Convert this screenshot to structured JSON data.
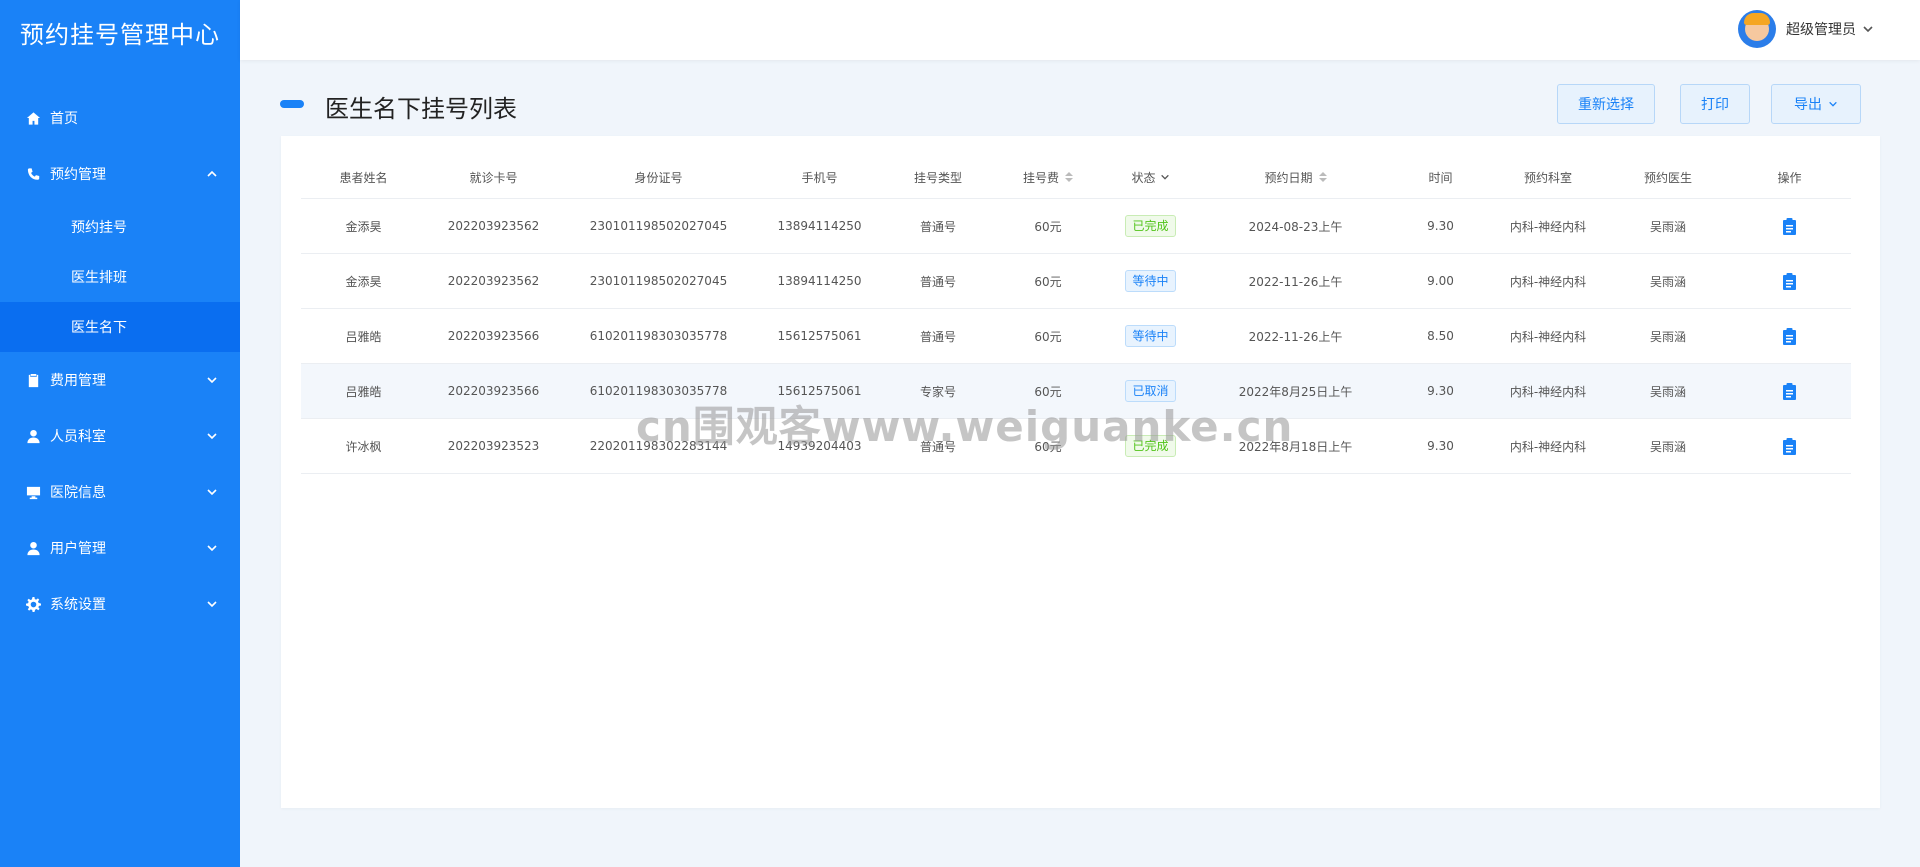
{
  "sidebar": {
    "brand": "预约挂号管理中心",
    "items": [
      {
        "label": "首页"
      },
      {
        "label": "预约管理",
        "children": [
          {
            "label": "预约挂号"
          },
          {
            "label": "医生排班"
          },
          {
            "label": "医生名下"
          }
        ]
      },
      {
        "label": "费用管理"
      },
      {
        "label": "人员科室"
      },
      {
        "label": "医院信息"
      },
      {
        "label": "用户管理"
      },
      {
        "label": "系统设置"
      }
    ]
  },
  "topbar": {
    "user_name": "超级管理员"
  },
  "page": {
    "title": "医生名下挂号列表",
    "buttons": {
      "reset": "重新选择",
      "print": "打印",
      "export": "导出"
    }
  },
  "table": {
    "headers": [
      "患者姓名",
      "就诊卡号",
      "身份证号",
      "手机号",
      "挂号类型",
      "挂号费",
      "状态",
      "预约日期",
      "时间",
      "预约科室",
      "预约医生",
      "操作"
    ],
    "rows": [
      {
        "name": "金添昊",
        "card": "202203923562",
        "id": "230101198502027045",
        "phone": "13894114250",
        "type": "普通号",
        "fee": "60元",
        "status": "已完成",
        "date": "2024-08-23上午",
        "time": "9.30",
        "dept": "内科-神经内科",
        "doctor": "吴雨涵"
      },
      {
        "name": "金添昊",
        "card": "202203923562",
        "id": "230101198502027045",
        "phone": "13894114250",
        "type": "普通号",
        "fee": "60元",
        "status": "等待中",
        "date": "2022-11-26上午",
        "time": "9.00",
        "dept": "内科-神经内科",
        "doctor": "吴雨涵"
      },
      {
        "name": "吕雅皓",
        "card": "202203923566",
        "id": "610201198303035778",
        "phone": "15612575061",
        "type": "普通号",
        "fee": "60元",
        "status": "等待中",
        "date": "2022-11-26上午",
        "time": "8.50",
        "dept": "内科-神经内科",
        "doctor": "吴雨涵"
      },
      {
        "name": "吕雅皓",
        "card": "202203923566",
        "id": "610201198303035778",
        "phone": "15612575061",
        "type": "专家号",
        "fee": "60元",
        "status": "已取消",
        "date": "2022年8月25日上午",
        "time": "9.30",
        "dept": "内科-神经内科",
        "doctor": "吴雨涵"
      },
      {
        "name": "许冰枫",
        "card": "202203923523",
        "id": "220201198302283144",
        "phone": "14939204403",
        "type": "普通号",
        "fee": "60元",
        "status": "已完成",
        "date": "2022年8月18日上午",
        "time": "9.30",
        "dept": "内科-神经内科",
        "doctor": "吴雨涵"
      }
    ]
  },
  "watermark": "cn围观客www.weiguanke.cn",
  "colors": {
    "primary": "#1a82f7",
    "active_menu": "#0a6ef0",
    "done": "#52c41a",
    "waiting": "#1a82f7"
  }
}
